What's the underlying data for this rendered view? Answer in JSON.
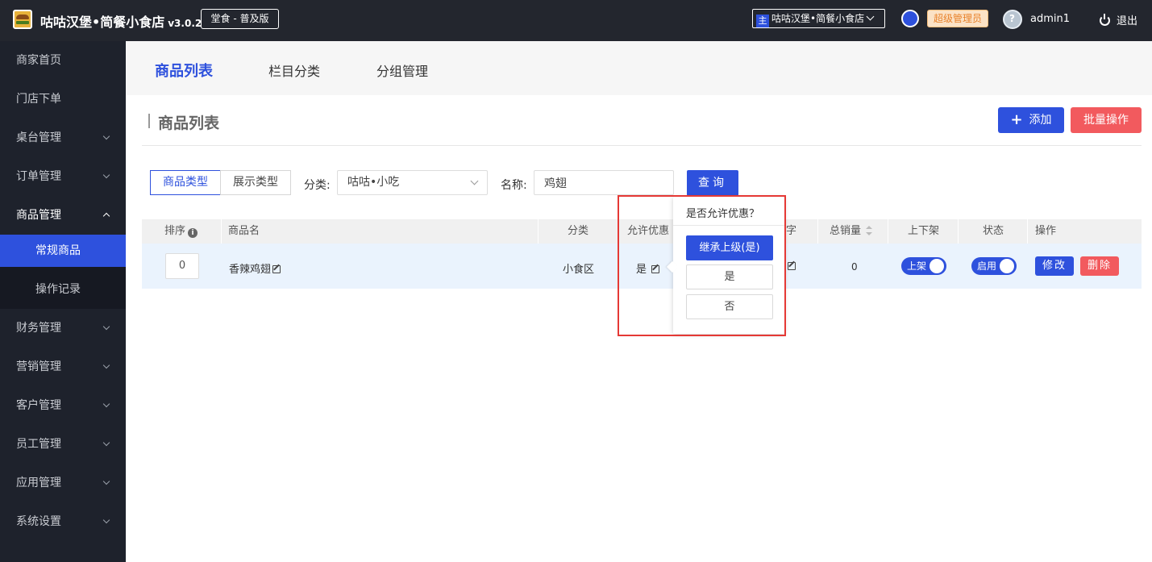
{
  "header": {
    "app_title": "咕咕汉堡•简餐小食店",
    "version": "v3.0.2",
    "edition": "堂食 - 普及版",
    "store_badge": "主",
    "store_name": "咕咕汉堡•简餐小食店",
    "role": "超级管理员",
    "username": "admin1",
    "logout": "退出",
    "accent_color": "#2e51dd",
    "danger_color": "#f25a5e"
  },
  "sidebar": {
    "items": [
      {
        "label": "商家首页"
      },
      {
        "label": "门店下单"
      },
      {
        "label": "桌台管理"
      },
      {
        "label": "订单管理"
      },
      {
        "label": "商品管理"
      },
      {
        "label": "财务管理"
      },
      {
        "label": "营销管理"
      },
      {
        "label": "客户管理"
      },
      {
        "label": "员工管理"
      },
      {
        "label": "应用管理"
      },
      {
        "label": "系统设置"
      }
    ],
    "sub_items": [
      {
        "label": "常规商品"
      },
      {
        "label": "操作记录"
      }
    ]
  },
  "tabs": [
    {
      "label": "商品列表"
    },
    {
      "label": "栏目分类"
    },
    {
      "label": "分组管理"
    }
  ],
  "page": {
    "title": "商品列表",
    "add_label": "添加",
    "batch_label": "批量操作"
  },
  "filter": {
    "type_tabs": [
      "商品类型",
      "展示类型"
    ],
    "category_label": "分类:",
    "category_value": "咕咕•小吃",
    "name_label": "名称:",
    "name_value": "鸡翅",
    "query_label": "查询"
  },
  "table": {
    "headers": {
      "sort": "排序",
      "name": "商品名",
      "category": "分类",
      "discount": "允许优惠",
      "stock_partial": "字",
      "sales": "总销量",
      "shelf": "上下架",
      "status": "状态",
      "actions": "操作"
    },
    "rows": [
      {
        "sort": "0",
        "name": "香辣鸡翅",
        "category": "小食区",
        "discount": "是",
        "sales": "0",
        "shelf": "上架",
        "status": "启用",
        "edit": "修改",
        "delete": "删除"
      }
    ]
  },
  "popover": {
    "title": "是否允许优惠？",
    "options": [
      "继承上级(是)",
      "是",
      "否"
    ]
  }
}
